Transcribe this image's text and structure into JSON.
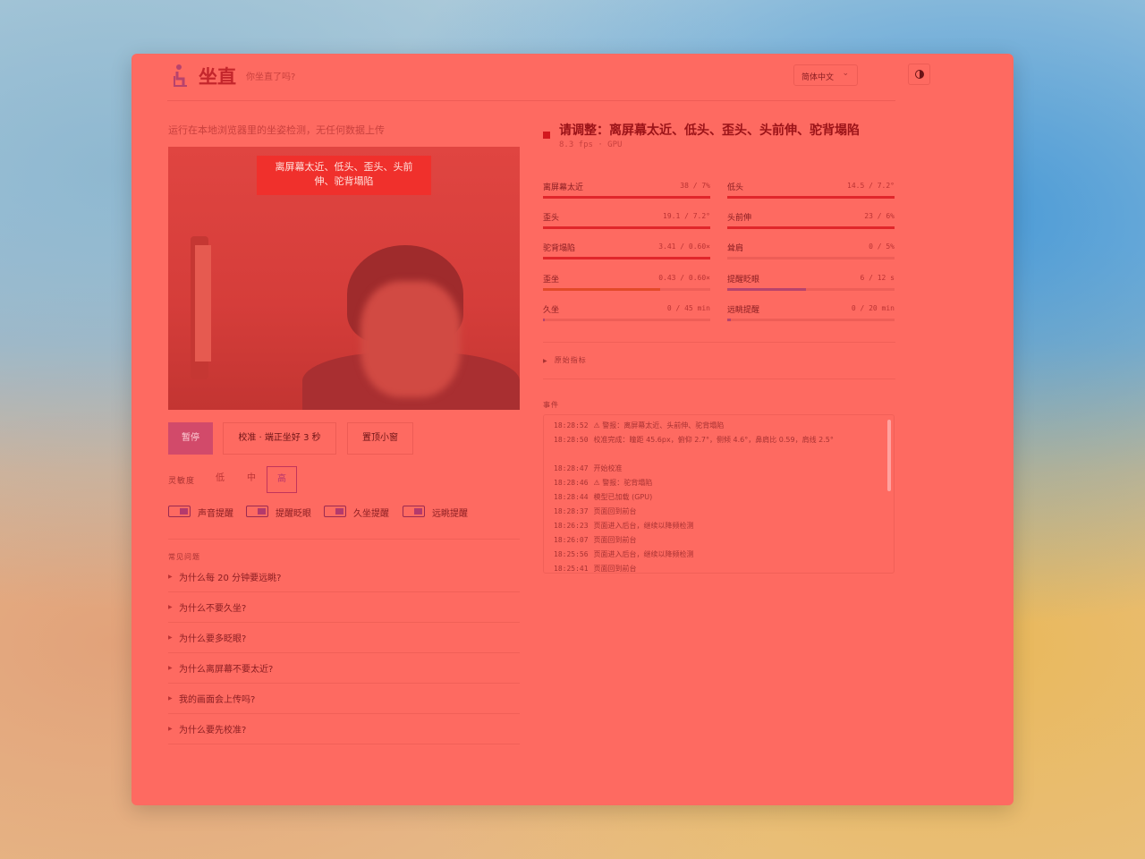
{
  "header": {
    "title": "坐直",
    "tagline": "你坐直了吗?",
    "language": "简体中文"
  },
  "subtitle": "运行在本地浏览器里的坐姿检测，无任何数据上传",
  "camera": {
    "alert": "离屏幕太近、低头、歪头、头前伸、驼背塌陷"
  },
  "controls": {
    "pause": "暂停",
    "calibrate": "校准 · 端正坐好 3 秒",
    "pip": "置顶小窗"
  },
  "sensitivity": {
    "label": "灵敏度",
    "options": [
      "低",
      "中",
      "高"
    ],
    "selected": "高"
  },
  "toggles": [
    "声音提醒",
    "提醒眨眼",
    "久坐提醒",
    "远眺提醒"
  ],
  "faq": {
    "title": "常见问题",
    "items": [
      "为什么每 20 分钟要远眺?",
      "为什么不要久坐?",
      "为什么要多眨眼?",
      "为什么离屏幕不要太近?",
      "我的画面会上传吗?",
      "为什么要先校准?"
    ]
  },
  "status": {
    "title": "请调整：离屏幕太近、低头、歪头、头前伸、驼背塌陷",
    "sub": "8.3 fps · GPU"
  },
  "metrics": [
    {
      "label": "离屏幕太近",
      "value": "38 / 7%",
      "level": 1.0,
      "color": "#e0262b"
    },
    {
      "label": "低头",
      "value": "14.5 / 7.2°",
      "level": 1.0,
      "color": "#e0262b"
    },
    {
      "label": "歪头",
      "value": "19.1 / 7.2°",
      "level": 1.0,
      "color": "#e0262b"
    },
    {
      "label": "头前伸",
      "value": "23 / 6%",
      "level": 1.0,
      "color": "#e0262b"
    },
    {
      "label": "驼背塌陷",
      "value": "3.41 / 0.60×",
      "level": 1.0,
      "color": "#e0262b"
    },
    {
      "label": "耸肩",
      "value": "0 / 5%",
      "level": 0.0,
      "color": "#e0262b"
    },
    {
      "label": "歪坐",
      "value": "0.43 / 0.60×",
      "level": 0.7,
      "color": "#e34a2a"
    },
    {
      "label": "提醒眨眼",
      "value": "6 / 12 s",
      "level": 0.47,
      "color": "#b8436c"
    },
    {
      "label": "久坐",
      "value": "0 / 45 min",
      "level": 0.01,
      "color": "#b8436c"
    },
    {
      "label": "远眺提醒",
      "value": "0 / 20 min",
      "level": 0.02,
      "color": "#b8436c"
    }
  ],
  "raw_metrics_label": "原始指标",
  "events": {
    "label": "事件",
    "items": [
      {
        "time": "18:28:52",
        "text": "⚠ 警报：离屏幕太近、头前伸、驼背塌陷"
      },
      {
        "time": "18:28:50",
        "text": "校准完成：瞳距 45.6px，俯仰 2.7°，侧倾 4.6°，鼻肩比 0.59，肩线 2.5°"
      },
      {
        "time": "18:28:47",
        "text": "开始校准"
      },
      {
        "time": "18:28:46",
        "text": "⚠ 警报：驼背塌陷"
      },
      {
        "time": "18:28:44",
        "text": "模型已加载 (GPU)"
      },
      {
        "time": "18:28:37",
        "text": "页面回到前台"
      },
      {
        "time": "18:26:23",
        "text": "页面进入后台，继续以降频检测"
      },
      {
        "time": "18:26:07",
        "text": "页面回到前台"
      },
      {
        "time": "18:25:56",
        "text": "页面进入后台，继续以降频检测"
      },
      {
        "time": "18:25:41",
        "text": "页面回到前台"
      }
    ]
  },
  "colors": {
    "panel": "#fe6a61",
    "accent": "#d3181f",
    "toggle_accent": "#b8436c"
  }
}
